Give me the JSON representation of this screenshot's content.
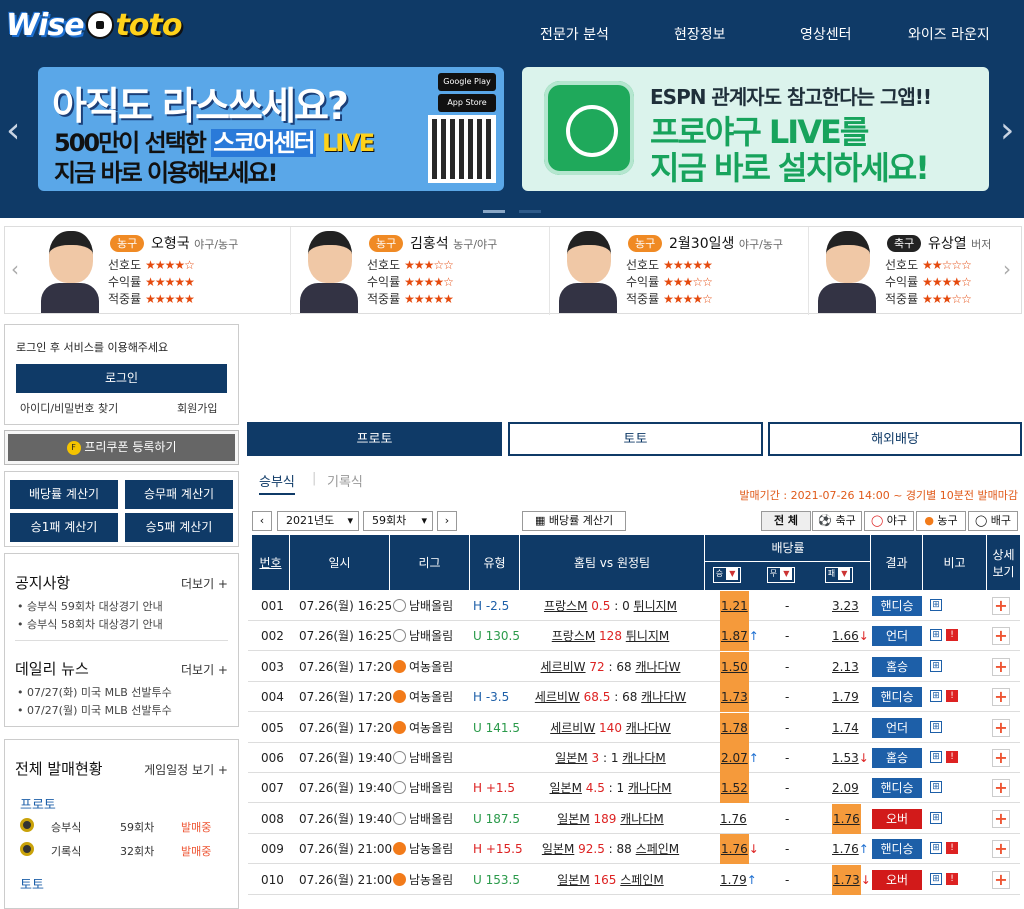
{
  "brand": {
    "wise": "Wise",
    "toto": "toto"
  },
  "nav": [
    "전문가 분석",
    "현장정보",
    "영상센터",
    "와이즈 라운지"
  ],
  "banner1": {
    "line1": "아직도 라스쓰세요?",
    "line2a": "500만이 선택한 ",
    "line2b": "스코어센터",
    "line2c": " LIVE",
    "line3": "지금 바로 이용해보세요!",
    "gp": "Google Play",
    "as": "App Store"
  },
  "banner2": {
    "line1": "ESPN 관계자도 참고한다는 그앱!!",
    "line2": "프로야구 LIVE를",
    "line3": "지금 바로 설치하세요!"
  },
  "experts": [
    {
      "sport": "농구",
      "name": "오형국",
      "cat": "야구/농구",
      "color": "#f08a24",
      "r": [
        "선호도",
        "수익률",
        "적중률"
      ],
      "s": [
        "★★★★☆",
        "★★★★★",
        "★★★★★"
      ]
    },
    {
      "sport": "농구",
      "name": "김홍석",
      "cat": "농구/야구",
      "color": "#f08a24",
      "r": [
        "선호도",
        "수익률",
        "적중률"
      ],
      "s": [
        "★★★☆☆",
        "★★★★☆",
        "★★★★★"
      ]
    },
    {
      "sport": "농구",
      "name": "2월30일생",
      "cat": "야구/농구",
      "color": "#f08a24",
      "r": [
        "선호도",
        "수익률",
        "적중률"
      ],
      "s": [
        "★★★★★",
        "★★★☆☆",
        "★★★★☆"
      ]
    },
    {
      "sport": "축구",
      "name": "유상열",
      "cat": "버저",
      "color": "#222",
      "r": [
        "선호도",
        "수익률",
        "적중률"
      ],
      "s": [
        "★★☆☆☆",
        "★★★★☆",
        "★★★☆☆"
      ]
    }
  ],
  "login": {
    "msg": "로그인 후 서비스를 이용해주세요",
    "button": "로그인",
    "find": "아이디/비밀번호 찾기",
    "join": "회원가입"
  },
  "coupon": "프리쿠폰 등록하기",
  "calcs": [
    "배당률 계산기",
    "승무패 계산기",
    "승1패 계산기",
    "승5패 계산기"
  ],
  "notice": {
    "title": "공지사항",
    "more": "더보기 +",
    "items": [
      "• 승부식 59회차 대상경기 안내",
      "• 승부식 58회차 대상경기 안내"
    ]
  },
  "daily": {
    "title": "데일리 뉴스",
    "more": "더보기 +",
    "items": [
      "• 07/27(화) 미국 MLB 선발투수",
      "• 07/27(월) 미국 MLB 선발투수"
    ]
  },
  "sales": {
    "title": "전체 발매현황",
    "more": "게임일정 보기 +",
    "proto": "프로토",
    "toto": "토토",
    "rows": [
      {
        "n": "승부식",
        "r": "59회차",
        "s": "발매중"
      },
      {
        "n": "기록식",
        "r": "32회차",
        "s": "발매중"
      }
    ]
  },
  "tabs": [
    "프로토",
    "토토",
    "해외배당"
  ],
  "subtabs": [
    "승부식",
    "기록식"
  ],
  "period": "발매기간 : 2021-07-26 14:00 ~ 경기별 10분전 발매마감",
  "controls": {
    "year": "2021년도",
    "round": "59회차",
    "calc": "배당률 계산기",
    "all": "전 체",
    "sports": [
      "축구",
      "야구",
      "농구",
      "배구"
    ]
  },
  "headers": {
    "no": "번호",
    "date": "일시",
    "league": "리그",
    "type": "유형",
    "match": "홈팀 vs 원정팀",
    "odds": "배당률",
    "w": "승",
    "d": "무",
    "l": "패",
    "result": "결과",
    "note": "비고",
    "detail": "상세 보기"
  },
  "rows": [
    {
      "no": "001",
      "date": "07.26(월) 16:25",
      "lg": "남배올림",
      "f": false,
      "type": "H -2.5",
      "tc": "#1d5fa8",
      "home": "프랑스M",
      "hs": "0.5",
      "sep": ":",
      "as": "0",
      "away": "튀니지M",
      "w": "1.21",
      "wh": true,
      "d": "-",
      "l": "3.23",
      "lh": false,
      "res": "핸디승",
      "rc": "#1d5fa8",
      "wa": "",
      "la": "",
      "red": false
    },
    {
      "no": "002",
      "date": "07.26(월) 16:25",
      "lg": "남배올림",
      "f": false,
      "type": "U 130.5",
      "tc": "#2a9a4a",
      "home": "프랑스M",
      "hs": "128",
      "sep": "",
      "as": "",
      "away": "튀니지M",
      "w": "1.87",
      "wh": true,
      "d": "-",
      "l": "1.66",
      "lh": false,
      "res": "언더",
      "rc": "#1d5fa8",
      "wa": "↑",
      "la": "↓",
      "red": true
    },
    {
      "no": "003",
      "date": "07.26(월) 17:20",
      "lg": "여농올림",
      "f": true,
      "type": "",
      "tc": "#222",
      "home": "세르비W",
      "hs": "72",
      "sep": ":",
      "as": "68",
      "away": "캐나다W",
      "w": "1.50",
      "wh": true,
      "d": "-",
      "l": "2.13",
      "lh": false,
      "res": "홈승",
      "rc": "#1d5fa8",
      "wa": "",
      "la": "",
      "red": false
    },
    {
      "no": "004",
      "date": "07.26(월) 17:20",
      "lg": "여농올림",
      "f": true,
      "type": "H -3.5",
      "tc": "#1d5fa8",
      "home": "세르비W",
      "hs": "68.5",
      "sep": ":",
      "as": "68",
      "away": "캐나다W",
      "w": "1.73",
      "wh": true,
      "d": "-",
      "l": "1.79",
      "lh": false,
      "res": "핸디승",
      "rc": "#1d5fa8",
      "wa": "",
      "la": "",
      "red": true
    },
    {
      "no": "005",
      "date": "07.26(월) 17:20",
      "lg": "여농올림",
      "f": true,
      "type": "U 141.5",
      "tc": "#2a9a4a",
      "home": "세르비W",
      "hs": "140",
      "sep": "",
      "as": "",
      "away": "캐나다W",
      "w": "1.78",
      "wh": true,
      "d": "-",
      "l": "1.74",
      "lh": false,
      "res": "언더",
      "rc": "#1d5fa8",
      "wa": "",
      "la": "",
      "red": false
    },
    {
      "no": "006",
      "date": "07.26(월) 19:40",
      "lg": "남배올림",
      "f": false,
      "type": "",
      "tc": "#222",
      "home": "일본M",
      "hs": "3",
      "sep": ":",
      "as": "1",
      "away": "캐나다M",
      "w": "2.07",
      "wh": true,
      "d": "-",
      "l": "1.53",
      "lh": false,
      "res": "홈승",
      "rc": "#1d5fa8",
      "wa": "↑",
      "la": "↓",
      "red": true
    },
    {
      "no": "007",
      "date": "07.26(월) 19:40",
      "lg": "남배올림",
      "f": false,
      "type": "H +1.5",
      "tc": "#d22",
      "home": "일본M",
      "hs": "4.5",
      "sep": ":",
      "as": "1",
      "away": "캐나다M",
      "w": "1.52",
      "wh": true,
      "d": "-",
      "l": "2.09",
      "lh": false,
      "res": "핸디승",
      "rc": "#1d5fa8",
      "wa": "",
      "la": "",
      "red": false
    },
    {
      "no": "008",
      "date": "07.26(월) 19:40",
      "lg": "남배올림",
      "f": false,
      "type": "U 187.5",
      "tc": "#2a9a4a",
      "home": "일본M",
      "hs": "189",
      "sep": "",
      "as": "",
      "away": "캐나다M",
      "w": "1.76",
      "wh": false,
      "d": "-",
      "l": "1.76",
      "lh": true,
      "res": "오버",
      "rc": "#d21a1a",
      "wa": "",
      "la": "",
      "red": false
    },
    {
      "no": "009",
      "date": "07.26(월) 21:00",
      "lg": "남농올림",
      "f": true,
      "type": "H +15.5",
      "tc": "#d22",
      "home": "일본M",
      "hs": "92.5",
      "sep": ":",
      "as": "88",
      "away": "스페인M",
      "w": "1.76",
      "wh": true,
      "d": "-",
      "l": "1.76",
      "lh": false,
      "res": "핸디승",
      "rc": "#1d5fa8",
      "wa": "↓",
      "la": "↑",
      "red": true
    },
    {
      "no": "010",
      "date": "07.26(월) 21:00",
      "lg": "남농올림",
      "f": true,
      "type": "U 153.5",
      "tc": "#2a9a4a",
      "home": "일본M",
      "hs": "165",
      "sep": "",
      "as": "",
      "away": "스페인M",
      "w": "1.79",
      "wh": false,
      "d": "-",
      "l": "1.73",
      "lh": true,
      "res": "오버",
      "rc": "#d21a1a",
      "wa": "↑",
      "la": "↓",
      "red": true
    }
  ]
}
